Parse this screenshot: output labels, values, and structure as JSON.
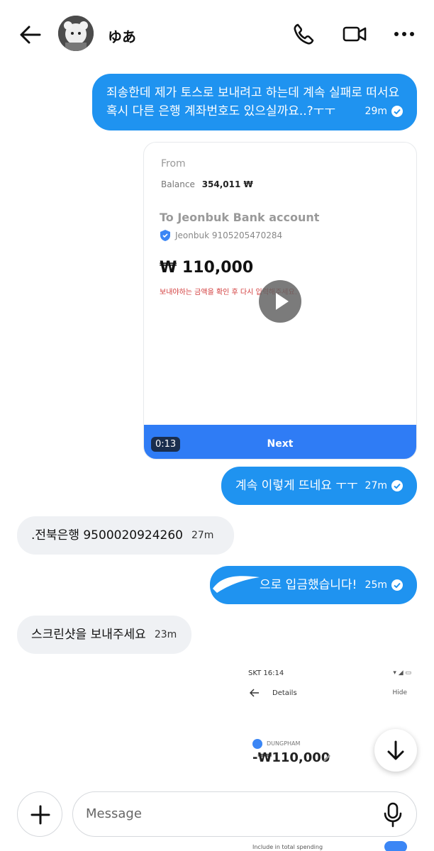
{
  "header": {
    "contact_name": "ゆあ",
    "icons": [
      "back-arrow-icon",
      "phone-icon",
      "video-call-icon",
      "more-options-icon"
    ]
  },
  "messages": [
    {
      "dir": "out",
      "lines": [
        "죄송한데 제가 토스로 보내려고 하는데 계속 실패로 떠서요",
        "혹시 다른 은행 계좌번호도 있으실까요..?ㅜㅜ"
      ],
      "time": "29m"
    },
    {
      "dir": "out",
      "type": "video",
      "duration": "0:13"
    },
    {
      "dir": "out",
      "text": "계속 이렇게 뜨네요 ㅜㅜ",
      "time": "27m"
    },
    {
      "dir": "in",
      "text": ".전북은행 9500020924260",
      "time": "27m"
    },
    {
      "dir": "out",
      "text": "으로 입금했습니다!",
      "time": "25m"
    },
    {
      "dir": "in",
      "text": "스크린샷을 보내주세요",
      "time": "23m"
    },
    {
      "dir": "out",
      "type": "image"
    }
  ],
  "video_preview": {
    "from_label": "From",
    "balance_label": "Balance",
    "balance_value": "354,011 ₩",
    "to_label": "To Jeonbuk Bank account",
    "account": "Jeonbuk 9105205470284",
    "amount": "₩ 110,000",
    "warning": "보내야하는 금액을 확인 후 다시 입력해주세요.",
    "next_button": "Next",
    "duration": "0:13"
  },
  "image_preview": {
    "status_time": "SKT 16:14",
    "title": "Details",
    "hide": "Hide",
    "name": "DUNGPHAM",
    "amount": "-₩110,000",
    "footer": "Include in total spending"
  },
  "composer": {
    "placeholder": "Message"
  },
  "colors": {
    "outgoing": "#1f93f0",
    "incoming": "#eff1f4",
    "next_bar": "#2f7cf5",
    "warning": "#d23b3b"
  }
}
